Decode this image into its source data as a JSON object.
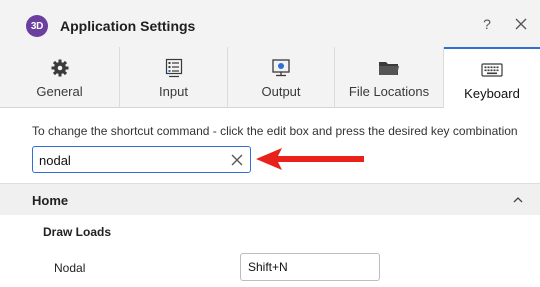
{
  "window": {
    "app_icon_text": "3D",
    "title": "Application Settings",
    "help_label": "?",
    "icons": {
      "app": "app-logo-icon",
      "close": "close-icon"
    }
  },
  "tabs": [
    {
      "label": "General",
      "icon": "gear-icon",
      "active": false
    },
    {
      "label": "Input",
      "icon": "input-list-icon",
      "active": false
    },
    {
      "label": "Output",
      "icon": "monitor-icon",
      "active": false
    },
    {
      "label": "File Locations",
      "icon": "folder-icon",
      "active": false
    },
    {
      "label": "Keyboard",
      "icon": "keyboard-icon",
      "active": true
    }
  ],
  "instruction": "To change the shortcut command - click the edit box and press the desired key combination",
  "search": {
    "value": "nodal",
    "clear_icon": "clear-icon"
  },
  "annotation": {
    "icon": "red-arrow-icon",
    "color": "#e8211a"
  },
  "section": {
    "title": "Home",
    "expanded": true,
    "icon": "chevron-up-icon"
  },
  "group": {
    "title": "Draw Loads"
  },
  "shortcut_row": {
    "label": "Nodal",
    "value": "Shift+N"
  },
  "colors": {
    "accent": "#2f6fd8",
    "app_icon": "#6b3fa0",
    "arrow": "#e8211a"
  }
}
